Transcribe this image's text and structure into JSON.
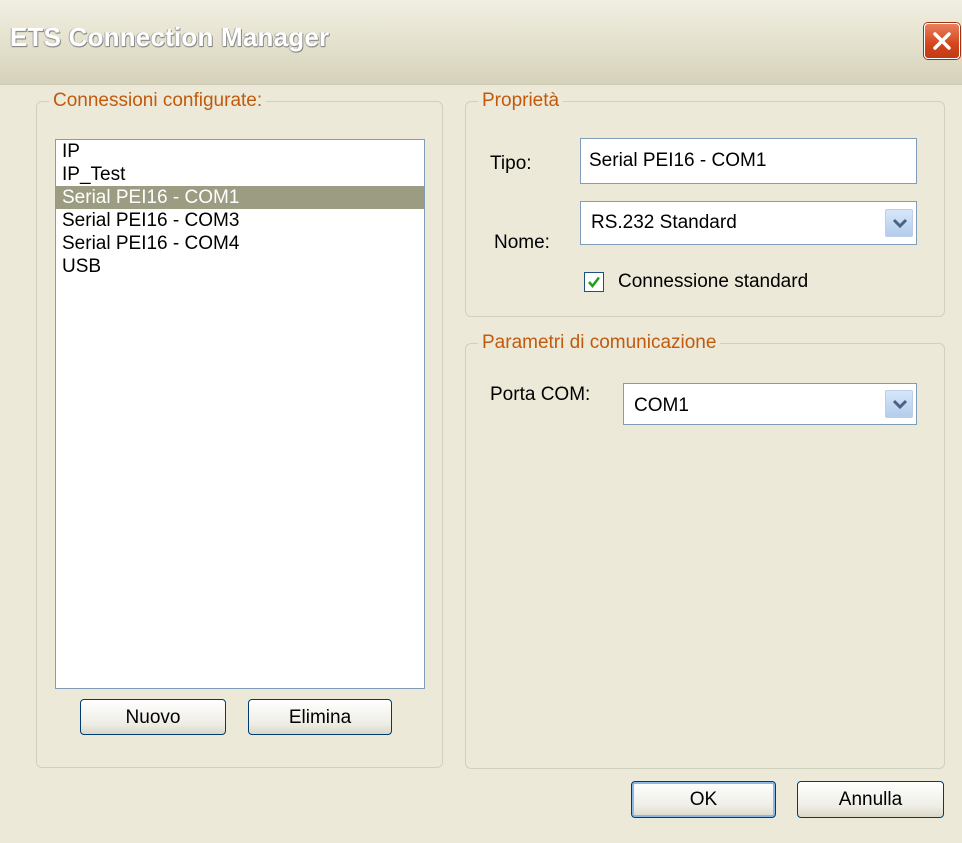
{
  "window": {
    "title": "ETS Connection Manager"
  },
  "connections": {
    "legend": "Connessioni configurate:",
    "items": [
      "IP",
      "IP_Test",
      "Serial PEI16 - COM1",
      "Serial PEI16 - COM3",
      "Serial PEI16 - COM4",
      "USB"
    ],
    "selected": "Serial PEI16 - COM1",
    "new_button": "Nuovo",
    "delete_button": "Elimina"
  },
  "properties": {
    "legend": "Proprietà",
    "type_label": "Tipo:",
    "type_value": "Serial PEI16 - COM1",
    "name_label": "Nome:",
    "name_value": "RS.232 Standard",
    "default_checkbox_label": "Connessione standard",
    "default_checked": true
  },
  "communication": {
    "legend": "Parametri di comunicazione",
    "port_label": "Porta COM:",
    "port_value": "COM1"
  },
  "footer": {
    "ok_button": "OK",
    "cancel_button": "Annulla"
  },
  "colors": {
    "title_bar": "#e3e0cc",
    "legend_text": "#c25a0e",
    "selection": "#9c9c82",
    "close_button": "#d2451d"
  }
}
